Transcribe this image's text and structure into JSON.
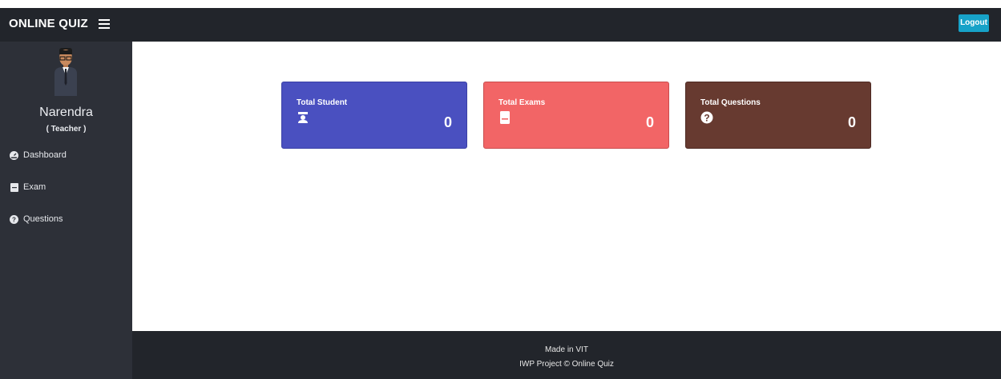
{
  "header": {
    "brand": "ONLINE QUIZ",
    "logout_label": "Logout"
  },
  "sidebar": {
    "user_name": "Narendra",
    "user_role": "( Teacher )",
    "items": [
      {
        "label": "Dashboard",
        "icon": "dashboard-icon"
      },
      {
        "label": "Exam",
        "icon": "book-icon"
      },
      {
        "label": "Questions",
        "icon": "question-circle-icon"
      }
    ]
  },
  "cards": [
    {
      "title": "Total Student",
      "value": "0",
      "icon": "graduation-icon",
      "color": "#4a50c0"
    },
    {
      "title": "Total Exams",
      "value": "0",
      "icon": "book-icon",
      "color": "#f26566"
    },
    {
      "title": "Total Questions",
      "value": "0",
      "icon": "question-circle-icon",
      "color": "#673a30"
    }
  ],
  "footer": {
    "line1": "Made in VIT",
    "line2": "IWP Project © Online Quiz"
  },
  "colors": {
    "navbar": "#22252b",
    "sidebar": "#2d3038",
    "logout": "#17a2c8"
  }
}
